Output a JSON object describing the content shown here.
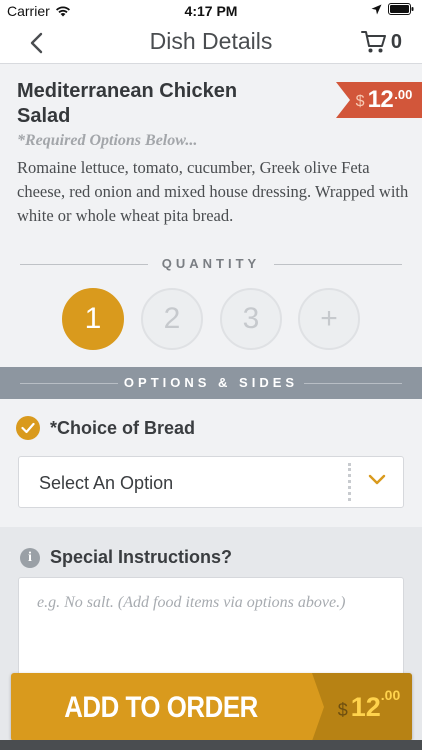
{
  "status_bar": {
    "carrier": "Carrier",
    "time": "4:17 PM"
  },
  "nav": {
    "title": "Dish Details",
    "cart_count": "0",
    "back_icon": "chevron-left-icon",
    "cart_icon": "cart-icon"
  },
  "dish": {
    "name": "Mediterranean Chicken Salad",
    "price_currency": "$",
    "price_dollars": "12",
    "price_cents": ".00",
    "required_note": "*Required Options Below...",
    "description": "Romaine lettuce, tomato, cucumber, Greek olive Feta cheese, red onion and mixed house dressing. Wrapped with white or whole wheat pita bread."
  },
  "quantity": {
    "label": "QUANTITY",
    "options": [
      "1",
      "2",
      "3",
      "+"
    ],
    "selected": "1",
    "accent_color": "#d99a1d"
  },
  "options": {
    "header": "OPTIONS & SIDES",
    "bread": {
      "title": "*Choice of Bread",
      "select_value": "Select An Option"
    }
  },
  "special": {
    "title": "Special Instructions?",
    "placeholder": "e.g. No salt. (Add food items via options above.)"
  },
  "add_button": {
    "label": "ADD TO ORDER",
    "price_currency": "$",
    "price_dollars": "12",
    "price_cents": ".00"
  }
}
